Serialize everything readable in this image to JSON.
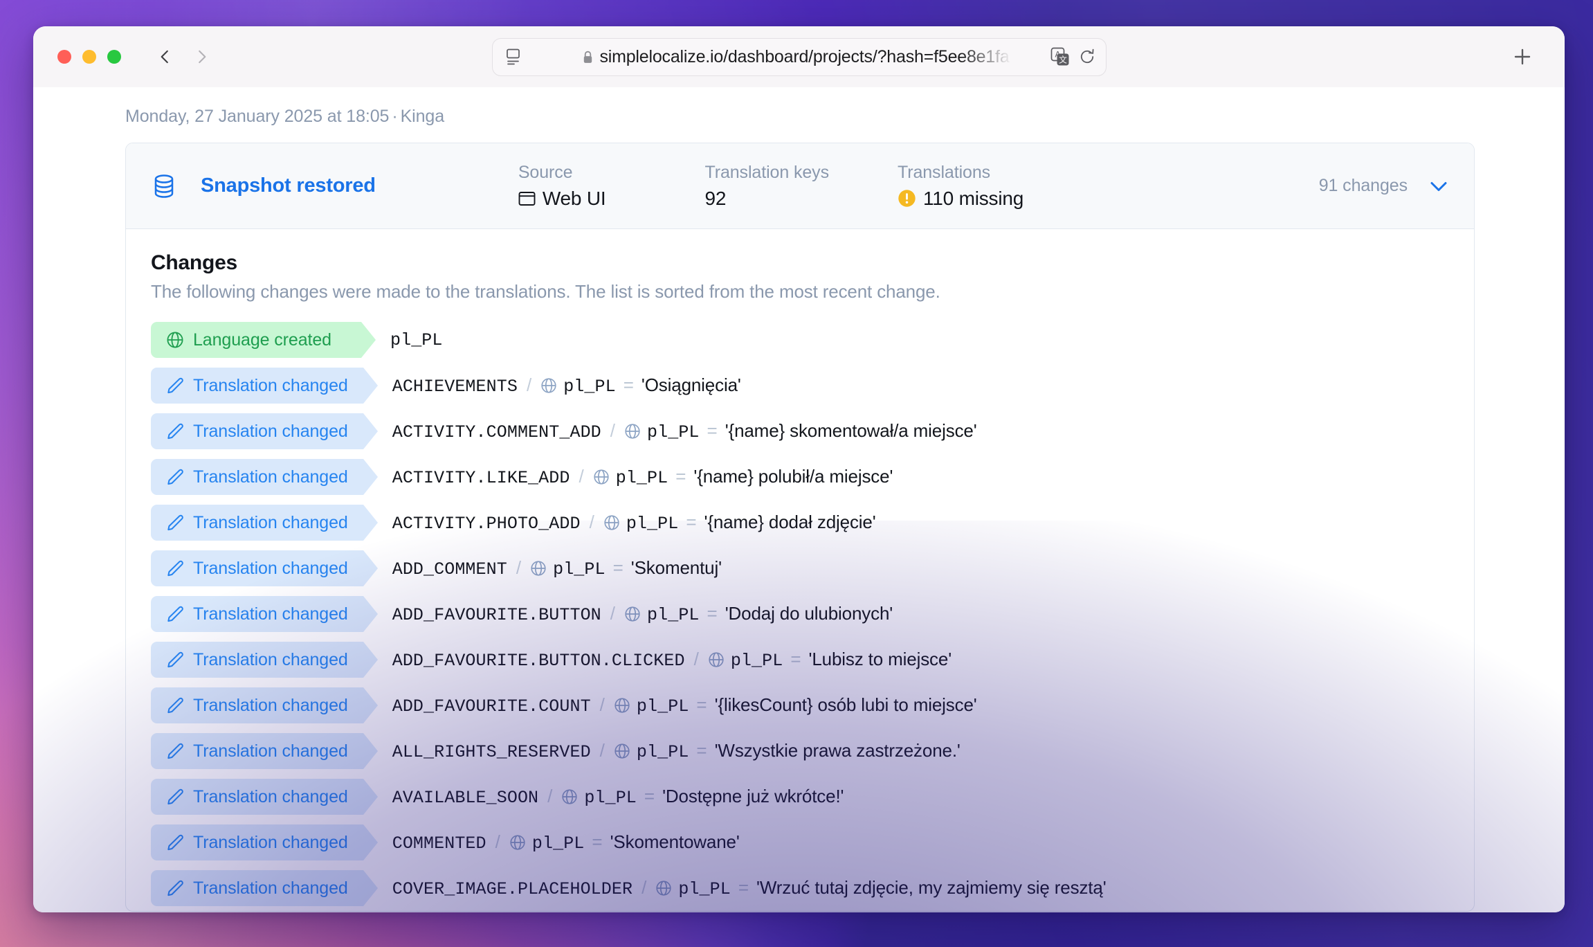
{
  "browser": {
    "url": "simplelocalize.io/dashboard/projects/?hash=f5ee8e1fa",
    "traffic_lights": [
      "close-button",
      "minimize-button",
      "maximize-button"
    ],
    "back_label": "Back",
    "forward_label": "Forward",
    "new_tab_label": "New Tab",
    "reader_icon": "reader-view-icon",
    "lock_icon": "lock-icon",
    "translate_icon": "translate-icon",
    "reload_icon": "reload-icon"
  },
  "page": {
    "timeline_date": "Monday, 27 January 2025 at 18:05",
    "timeline_separator": "·",
    "timeline_author": "Kinga"
  },
  "event": {
    "icon": "database-icon",
    "title": "Snapshot restored",
    "stats": [
      {
        "label": "Source",
        "value": "Web UI",
        "icon": "browser-window-icon"
      },
      {
        "label": "Translation keys",
        "value": "92",
        "icon": ""
      },
      {
        "label": "Translations",
        "value": "110 missing",
        "icon": "warning-icon"
      }
    ],
    "changes_count": "91 changes",
    "collapse_icon": "chevron-down-icon"
  },
  "changes": {
    "heading": "Changes",
    "subtitle": "The following changes were made to the translations. The list is sorted from the most recent change.",
    "rows": [
      {
        "type": "created",
        "badge": "Language created",
        "badge_icon": "globe-icon",
        "key": "pl_PL",
        "has_detail": false
      },
      {
        "type": "changed",
        "badge": "Translation changed",
        "badge_icon": "pencil-icon",
        "key": "ACHIEVEMENTS",
        "separator": "/",
        "locale_icon": "globe-icon",
        "locale": "pl_PL",
        "equals": "=",
        "value": "'Osiągnięcia'",
        "has_detail": true
      },
      {
        "type": "changed",
        "badge": "Translation changed",
        "badge_icon": "pencil-icon",
        "key": "ACTIVITY.COMMENT_ADD",
        "separator": "/",
        "locale_icon": "globe-icon",
        "locale": "pl_PL",
        "equals": "=",
        "value": "'{name} skomentował/a miejsce'",
        "has_detail": true
      },
      {
        "type": "changed",
        "badge": "Translation changed",
        "badge_icon": "pencil-icon",
        "key": "ACTIVITY.LIKE_ADD",
        "separator": "/",
        "locale_icon": "globe-icon",
        "locale": "pl_PL",
        "equals": "=",
        "value": "'{name} polubił/a miejsce'",
        "has_detail": true
      },
      {
        "type": "changed",
        "badge": "Translation changed",
        "badge_icon": "pencil-icon",
        "key": "ACTIVITY.PHOTO_ADD",
        "separator": "/",
        "locale_icon": "globe-icon",
        "locale": "pl_PL",
        "equals": "=",
        "value": "'{name} dodał zdjęcie'",
        "has_detail": true
      },
      {
        "type": "changed",
        "badge": "Translation changed",
        "badge_icon": "pencil-icon",
        "key": "ADD_COMMENT",
        "separator": "/",
        "locale_icon": "globe-icon",
        "locale": "pl_PL",
        "equals": "=",
        "value": "'Skomentuj'",
        "has_detail": true
      },
      {
        "type": "changed",
        "badge": "Translation changed",
        "badge_icon": "pencil-icon",
        "key": "ADD_FAVOURITE.BUTTON",
        "separator": "/",
        "locale_icon": "globe-icon",
        "locale": "pl_PL",
        "equals": "=",
        "value": "'Dodaj do ulubionych'",
        "has_detail": true
      },
      {
        "type": "changed",
        "badge": "Translation changed",
        "badge_icon": "pencil-icon",
        "key": "ADD_FAVOURITE.BUTTON.CLICKED",
        "separator": "/",
        "locale_icon": "globe-icon",
        "locale": "pl_PL",
        "equals": "=",
        "value": "'Lubisz to miejsce'",
        "has_detail": true
      },
      {
        "type": "changed",
        "badge": "Translation changed",
        "badge_icon": "pencil-icon",
        "key": "ADD_FAVOURITE.COUNT",
        "separator": "/",
        "locale_icon": "globe-icon",
        "locale": "pl_PL",
        "equals": "=",
        "value": "'{likesCount} osób lubi to miejsce'",
        "has_detail": true
      },
      {
        "type": "changed",
        "badge": "Translation changed",
        "badge_icon": "pencil-icon",
        "key": "ALL_RIGHTS_RESERVED",
        "separator": "/",
        "locale_icon": "globe-icon",
        "locale": "pl_PL",
        "equals": "=",
        "value": "'Wszystkie prawa zastrzeżone.'",
        "has_detail": true
      },
      {
        "type": "changed",
        "badge": "Translation changed",
        "badge_icon": "pencil-icon",
        "key": "AVAILABLE_SOON",
        "separator": "/",
        "locale_icon": "globe-icon",
        "locale": "pl_PL",
        "equals": "=",
        "value": "'Dostępne już wkrótce!'",
        "has_detail": true
      },
      {
        "type": "changed",
        "badge": "Translation changed",
        "badge_icon": "pencil-icon",
        "key": "COMMENTED",
        "separator": "/",
        "locale_icon": "globe-icon",
        "locale": "pl_PL",
        "equals": "=",
        "value": "'Skomentowane'",
        "has_detail": true
      },
      {
        "type": "changed",
        "badge": "Translation changed",
        "badge_icon": "pencil-icon",
        "key": "COVER_IMAGE.PLACEHOLDER",
        "separator": "/",
        "locale_icon": "globe-icon",
        "locale": "pl_PL",
        "equals": "=",
        "value": "'Wrzuć tutaj zdjęcie, my zajmiemy się resztą'",
        "has_detail": true
      }
    ]
  },
  "colors": {
    "accent_blue": "#1a73e8",
    "badge_changed_bg": "#d9e8fb",
    "badge_changed_fg": "#2684f0",
    "badge_created_bg": "#c8f7d4",
    "badge_created_fg": "#1e9e4f",
    "warning_amber": "#f5b922",
    "muted_text": "#8a98ad"
  }
}
